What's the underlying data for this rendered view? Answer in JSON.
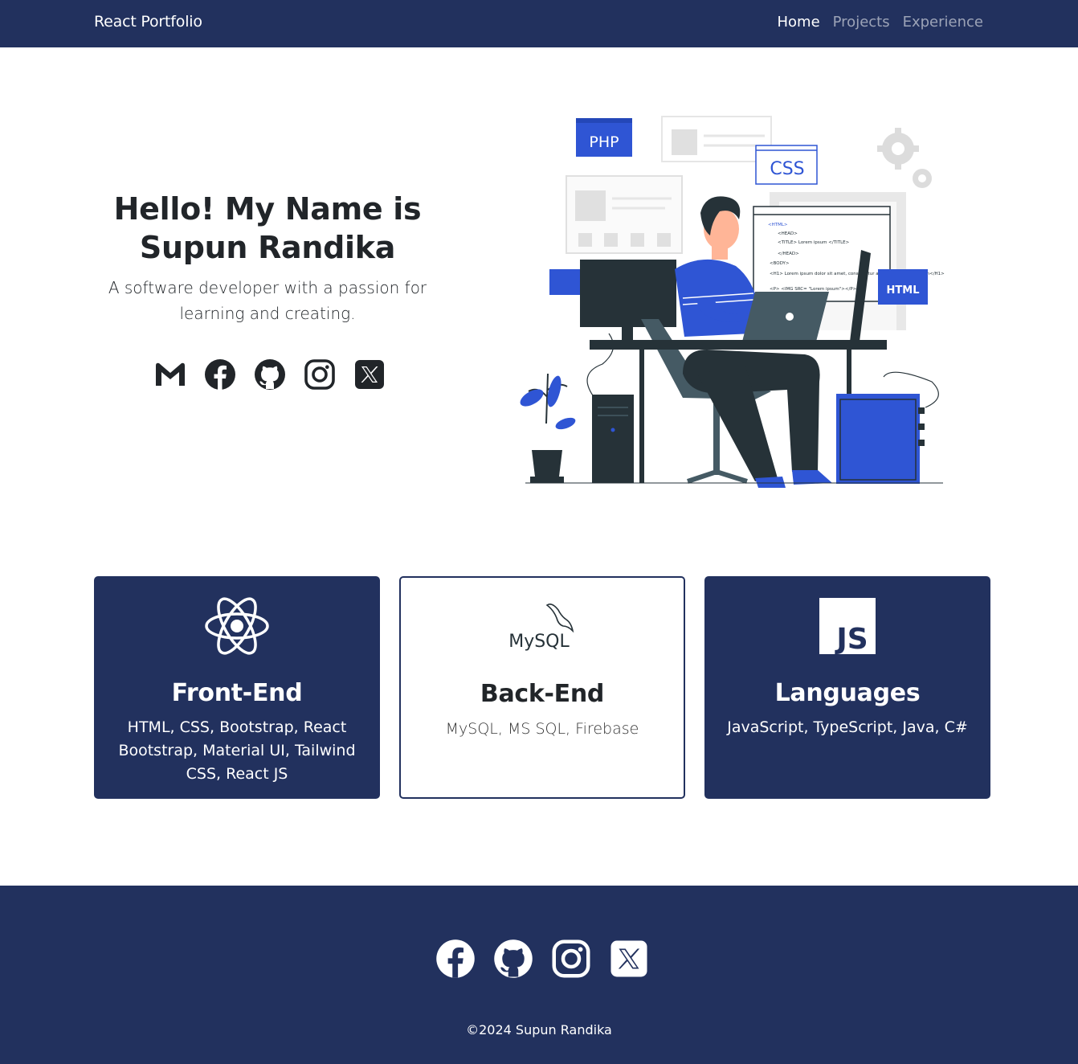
{
  "navbar": {
    "brand": "React Portfolio",
    "links": [
      {
        "label": "Home",
        "active": true
      },
      {
        "label": "Projects",
        "active": false
      },
      {
        "label": "Experience",
        "active": false
      }
    ]
  },
  "hero": {
    "title": "Hello! My Name is Supun Randika",
    "subtitle": "A software developer with a passion for learning and creating.",
    "social_icons": [
      "gmail-icon",
      "facebook-icon",
      "github-icon",
      "instagram-icon",
      "x-icon"
    ],
    "illustration": {
      "name": "developer-at-desk-illustration",
      "tags": [
        "PHP",
        "CSS",
        "HTML"
      ],
      "code_lines": [
        "<HTML>",
        "<HEAD>",
        "<TITLE> Lorem ipsum </TITLE>",
        "</HEAD>",
        "<BODY>",
        "<H1> Lorem ipsum dolor sit amet, consectetur adipiscing elit, sed diam</H1>",
        "<P> <IMG SRC= \"Lorem ipsum\"></P>"
      ]
    }
  },
  "cards": [
    {
      "style": "dark",
      "logo": "react-icon",
      "title": "Front-End",
      "description": "HTML, CSS, Bootstrap, React Bootstrap, Material UI, Tailwind CSS, React JS"
    },
    {
      "style": "light",
      "logo": "mysql-icon",
      "logo_text": "MySQL",
      "title": "Back-End",
      "description": "MySQL, MS SQL, Firebase"
    },
    {
      "style": "dark",
      "logo": "js-icon",
      "logo_text": "JS",
      "title": "Languages",
      "description": "JavaScript, TypeScript, Java, C#"
    }
  ],
  "footer": {
    "social_icons": [
      "facebook-icon",
      "github-icon",
      "instagram-icon",
      "x-icon"
    ],
    "copyright": "©2024 Supun Randika"
  },
  "colors": {
    "primary": "#22315e",
    "accent_blue": "#2f55d4",
    "white": "#ffffff",
    "text": "#212529"
  }
}
